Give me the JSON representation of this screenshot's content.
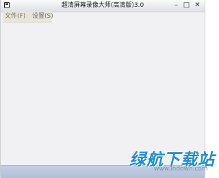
{
  "window": {
    "title": "超清屏幕录像大师(高清版)3.0",
    "minimize_glyph": "–",
    "maximize_glyph": "□",
    "close_glyph": "✕",
    "icon": "app-icon"
  },
  "menu": {
    "items": [
      {
        "label": "文件(F)"
      },
      {
        "label": "设置(S)"
      }
    ]
  },
  "watermark": {
    "logo": "绿航下载站",
    "url": "www.lhdown.com"
  },
  "colors": {
    "client_background": "#f1f1f3",
    "statusbar": "#b7c3db",
    "watermark_logo": "#1d8fd0"
  }
}
